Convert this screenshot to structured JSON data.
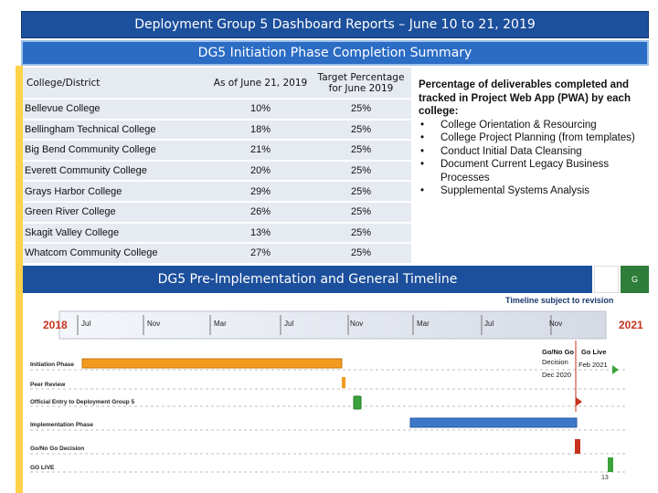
{
  "header": {
    "title": "Deployment Group 5 Dashboard Reports – June 10 to 21, 2019",
    "section_title": "DG5 Initiation Phase Completion Summary"
  },
  "summary_table": {
    "columns": [
      "College/District",
      "As of June 21, 2019",
      "Target Percentage for June 2019"
    ],
    "rows": [
      [
        "Bellevue College",
        "10%",
        "25%"
      ],
      [
        "Bellingham Technical College",
        "18%",
        "25%"
      ],
      [
        "Big Bend Community College",
        "21%",
        "25%"
      ],
      [
        "Everett Community College",
        "20%",
        "25%"
      ],
      [
        "Grays Harbor College",
        "29%",
        "25%"
      ],
      [
        "Green River College",
        "26%",
        "25%"
      ],
      [
        "Skagit Valley College",
        "13%",
        "25%"
      ],
      [
        "Whatcom Community College",
        "27%",
        "25%"
      ]
    ]
  },
  "notes": {
    "title": "Percentage of deliverables completed and tracked in Project Web App (PWA) by each college:",
    "items": [
      "College Orientation & Resourcing",
      "College Project Planning (from templates)",
      "Conduct Initial Data Cleansing",
      "Document Current Legacy Business Processes",
      "Supplemental Systems Analysis"
    ]
  },
  "timeline": {
    "title": "DG5 Pre-Implementation and General Timeline",
    "badge": "G",
    "subtitle": "Timeline subject to revision",
    "start_year": "2018",
    "end_year": "2021",
    "months": [
      "Jul",
      "Nov",
      "Mar",
      "Jul",
      "Nov",
      "Mar",
      "Jul",
      "Nov"
    ],
    "milestones": {
      "gonogo_label": "Go/No Go",
      "gonogo_sub1": "Decision",
      "gonogo_sub2": "Dec 2020",
      "golive_label": "Go Live",
      "golive_sub": "Feb 2021"
    },
    "rows": [
      "Initiation Phase",
      "Peer Review",
      "Official Entry to Deployment Group 5",
      "Implementation Phase",
      "Go/No Go Decision",
      "GO LIVE"
    ],
    "page_number": "13"
  }
}
